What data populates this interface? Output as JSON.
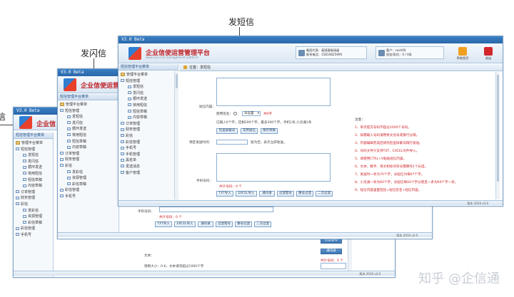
{
  "captions": {
    "send_sms": "发短信",
    "send_flash": "发闪信",
    "left_partial": "信"
  },
  "app": {
    "version": "V3.0 Beta",
    "brand_short": "企业信",
    "brand_mid": "企业信使运营",
    "brand_full": "企业信使运营管理平台",
    "brand_sub": "www.xxx.com   management platform",
    "sidebar_header": "短信管理平台菜单"
  },
  "tree": {
    "root": "管理平台菜单",
    "sms_manage": "短信管理",
    "send_sms": "发短信",
    "send_flash": "发闪信",
    "loop_send": "循环发送",
    "common_sms": "常用短信",
    "sms_draft": "短信草稿",
    "content_draft": "内容草稿",
    "order_manage": "订单管理",
    "finance_manage": "财务管理",
    "mms": "彩信",
    "mms_manage": "彩信管理",
    "send_mms": "发彩信",
    "mms_resource": "资源管理",
    "mms_draft": "彩信草稿",
    "phonebook": "手机号",
    "phonebook_manage": "手机管理",
    "lists": "黑名单",
    "sent_messages": "发送消息",
    "customer_manage": "客户管理"
  },
  "front_window": {
    "tab_label": "位置：发短信",
    "account_label1": "集团代表：泰国客服请谨",
    "account_label2": "联系电话：15810825995",
    "user_label1": "客户：cash00",
    "user_label2": "短信/彩信：0 / 0条",
    "home_btn": "系统首页",
    "exit_btn": "退出",
    "sms_content_label": "短信内容：",
    "sign_label": "使用签名：",
    "sign_value": "未设置",
    "sign_unit": "共0字",
    "char_count": "已输入0个字，还剩300个字，最多300个字，手机1条,小灵通1条",
    "btn_check_keyword": "检查屏蔽词",
    "btn_common": "常用短信",
    "btn_save_draft": "保存草稿",
    "schedule_label": "预定发送时间：",
    "schedule_hint": "留为空，表示立即发送。",
    "phone_label": "手机号码：",
    "phone_count": "共计号码：0 个",
    "btn_txt": "TXT导入",
    "btn_excel": "EXCEL导入",
    "btn_addressbook": "通讯录",
    "btn_filter": "过滤错号",
    "btn_dedupe": "重号过滤",
    "btn_second": "二次过滤",
    "notes_title": "注意：",
    "notes": [
      "1、单次提交号码不超过2000个号码。",
      "2、如需输入号码请用英文逗号或换行分隔。",
      "3、内容编辑完成后请先检查屏蔽词再行发送。",
      "4、号码文件只支持TXT、EXCEL文件导入。",
      "5、请使用CTRL+V粘贴短信内容。",
      "6、文本、数字、英文和标点符号都算作1个长度。",
      "7、发送时一条为70个字，长短信为每67个字。",
      "8、小灵通一条为60个字，长短信每64个字分割且一条为60个字一条。",
      "9、短信内容里面包括=短信签名+短信内容。"
    ],
    "status": "版本 2010 v2.0"
  },
  "mid_window": {
    "phone_label": "手机号码：",
    "phone_count": "共计号码：0 个",
    "status": "版本 2010 v2.0"
  },
  "back_window": {
    "btn_filter_err": "过滤错号",
    "btn_addressbook": "通讯录",
    "phone_count": "共计号码：0 个",
    "text_label": "文本：",
    "size_label": "限制大小：0 K，文本请勿超过1000个字",
    "status": "版本 2010 v2.0"
  },
  "watermark": "知乎 @企信通"
}
